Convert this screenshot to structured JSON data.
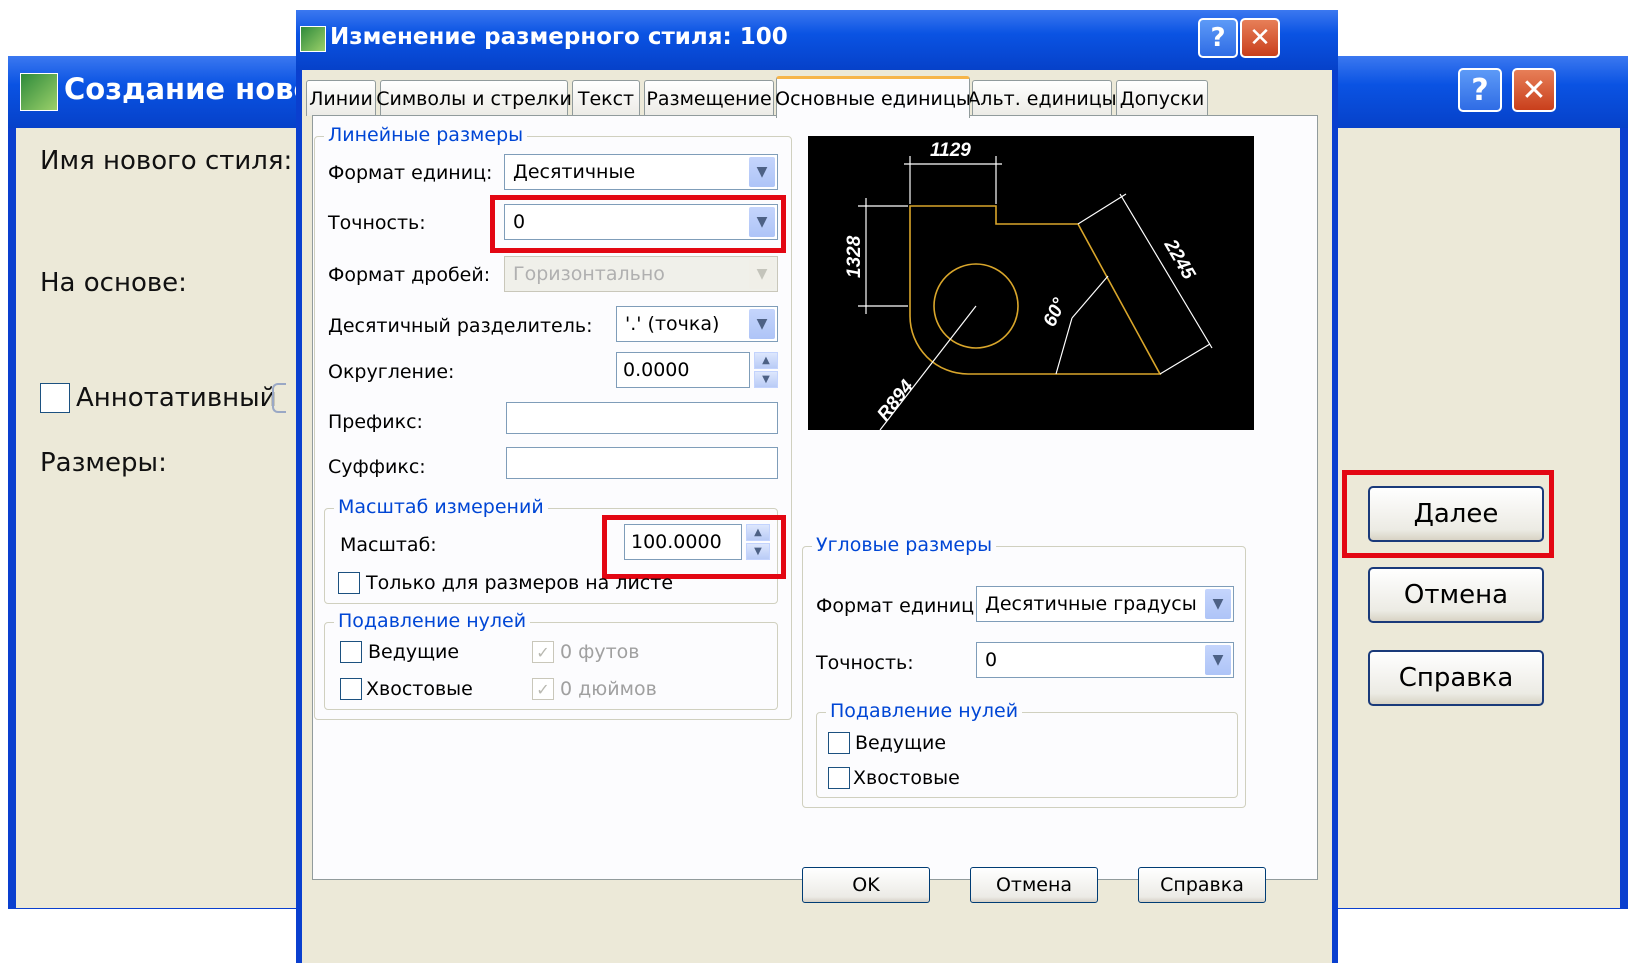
{
  "back_dialog": {
    "title": "Создание нового",
    "new_style_label": "Имя нового стиля:",
    "based_on_label": "На основе:",
    "annotative_label": "Аннотативный",
    "dimensions_label": "Размеры:",
    "buttons": {
      "next": "Далее",
      "cancel": "Отмена",
      "help": "Справка"
    },
    "help_glyph": "?",
    "close_glyph": "✕"
  },
  "front_dialog": {
    "title": "Изменение размерного стиля: 100",
    "help_glyph": "?",
    "close_glyph": "✕",
    "tabs": [
      "Линии",
      "Символы и стрелки",
      "Текст",
      "Размещение",
      "Основные единицы",
      "Альт. единицы",
      "Допуски"
    ],
    "active_tab": "Основные единицы",
    "linear": {
      "legend": "Линейные размеры",
      "unit_format_label": "Формат единиц:",
      "unit_format_value": "Десятичные",
      "precision_label": "Точность:",
      "precision_value": "0",
      "fraction_format_label": "Формат дробей:",
      "fraction_format_value": "Горизонтально",
      "decimal_separator_label": "Десятичный  разделитель:",
      "decimal_separator_value": "'.' (точка)",
      "round_off_label": "Округление:",
      "round_off_value": "0.0000",
      "prefix_label": "Префикс:",
      "prefix_value": "",
      "suffix_label": "Суффикс:",
      "suffix_value": ""
    },
    "measurement_scale": {
      "legend": "Масштаб измерений",
      "scale_label": "Масштаб:",
      "scale_value": "100.0000",
      "layout_only_label": "Только для размеров на листе",
      "layout_only_checked": false
    },
    "zero_suppression_linear": {
      "legend": "Подавление нулей",
      "leading_label": "Ведущие",
      "trailing_label": "Хвостовые",
      "feet_label": "0 футов",
      "inches_label": "0 дюймов",
      "check_glyph": "✓"
    },
    "preview": {
      "dim_top": "1129",
      "dim_left": "1328",
      "dim_right": "2245",
      "dim_angle": "60°",
      "dim_radius": "R894"
    },
    "angular": {
      "legend": "Угловые размеры",
      "unit_format_label": "Формат единиц:",
      "unit_format_value": "Десятичные градусы",
      "precision_label": "Точность:",
      "precision_value": "0"
    },
    "zero_suppression_angular": {
      "legend": "Подавление нулей",
      "leading_label": "Ведущие",
      "trailing_label": "Хвостовые"
    },
    "buttons": {
      "ok": "OK",
      "cancel": "Отмена",
      "help": "Справка"
    }
  },
  "colors": {
    "titlebar": "#0a53e3",
    "dialog_face": "#ece9d8",
    "highlight": "#e30713",
    "group_legend": "#0046d5",
    "drawing_outline": "#d9a62b",
    "drawing_dims": "#ffffff"
  }
}
